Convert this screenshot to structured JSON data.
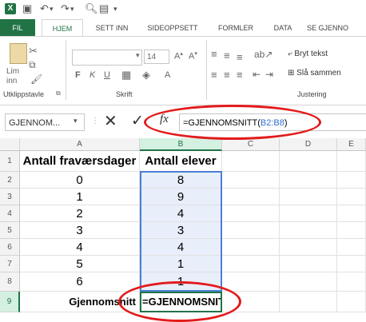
{
  "qat": {
    "undo_icon": "undo-icon",
    "redo_icon": "redo-icon"
  },
  "tabs": [
    {
      "label": "FIL"
    },
    {
      "label": "HJEM"
    },
    {
      "label": "SETT INN"
    },
    {
      "label": "SIDEOPPSETT"
    },
    {
      "label": "FORMLER"
    },
    {
      "label": "DATA"
    },
    {
      "label": "SE GJENNO"
    }
  ],
  "ribbon": {
    "paste_label": "Lim",
    "paste_sub": "inn",
    "clipboard_label": "Utklippstavle",
    "font_label": "Skrift",
    "font_size": "14",
    "bold": "F",
    "italic": "K",
    "underline": "U",
    "alignment_label": "Justering",
    "wrap_text": "Bryt tekst",
    "merge": "Slå sammen"
  },
  "formula_bar": {
    "name_box": "GJENNOM...",
    "fx": "fx",
    "formula_prefix": "=GJENNOMSNITT(",
    "formula_range": "B2:B8",
    "formula_suffix": ")"
  },
  "grid": {
    "columns": [
      "A",
      "B",
      "C",
      "D",
      "E"
    ],
    "rows": [
      {
        "num": "1",
        "a": "Antall fraværsdager",
        "b": "Antall elever"
      },
      {
        "num": "2",
        "a": "0",
        "b": "8"
      },
      {
        "num": "3",
        "a": "1",
        "b": "9"
      },
      {
        "num": "4",
        "a": "2",
        "b": "4"
      },
      {
        "num": "5",
        "a": "3",
        "b": "3"
      },
      {
        "num": "6",
        "a": "4",
        "b": "4"
      },
      {
        "num": "7",
        "a": "5",
        "b": "1"
      },
      {
        "num": "8",
        "a": "6",
        "b": "1"
      },
      {
        "num": "9",
        "a": "Gjennomsnitt",
        "b": "=GJENNOMSNITT"
      }
    ]
  },
  "colors": {
    "accent": "#217346",
    "highlight": "#e21b1b",
    "range_ref": "#2f6fd0"
  }
}
